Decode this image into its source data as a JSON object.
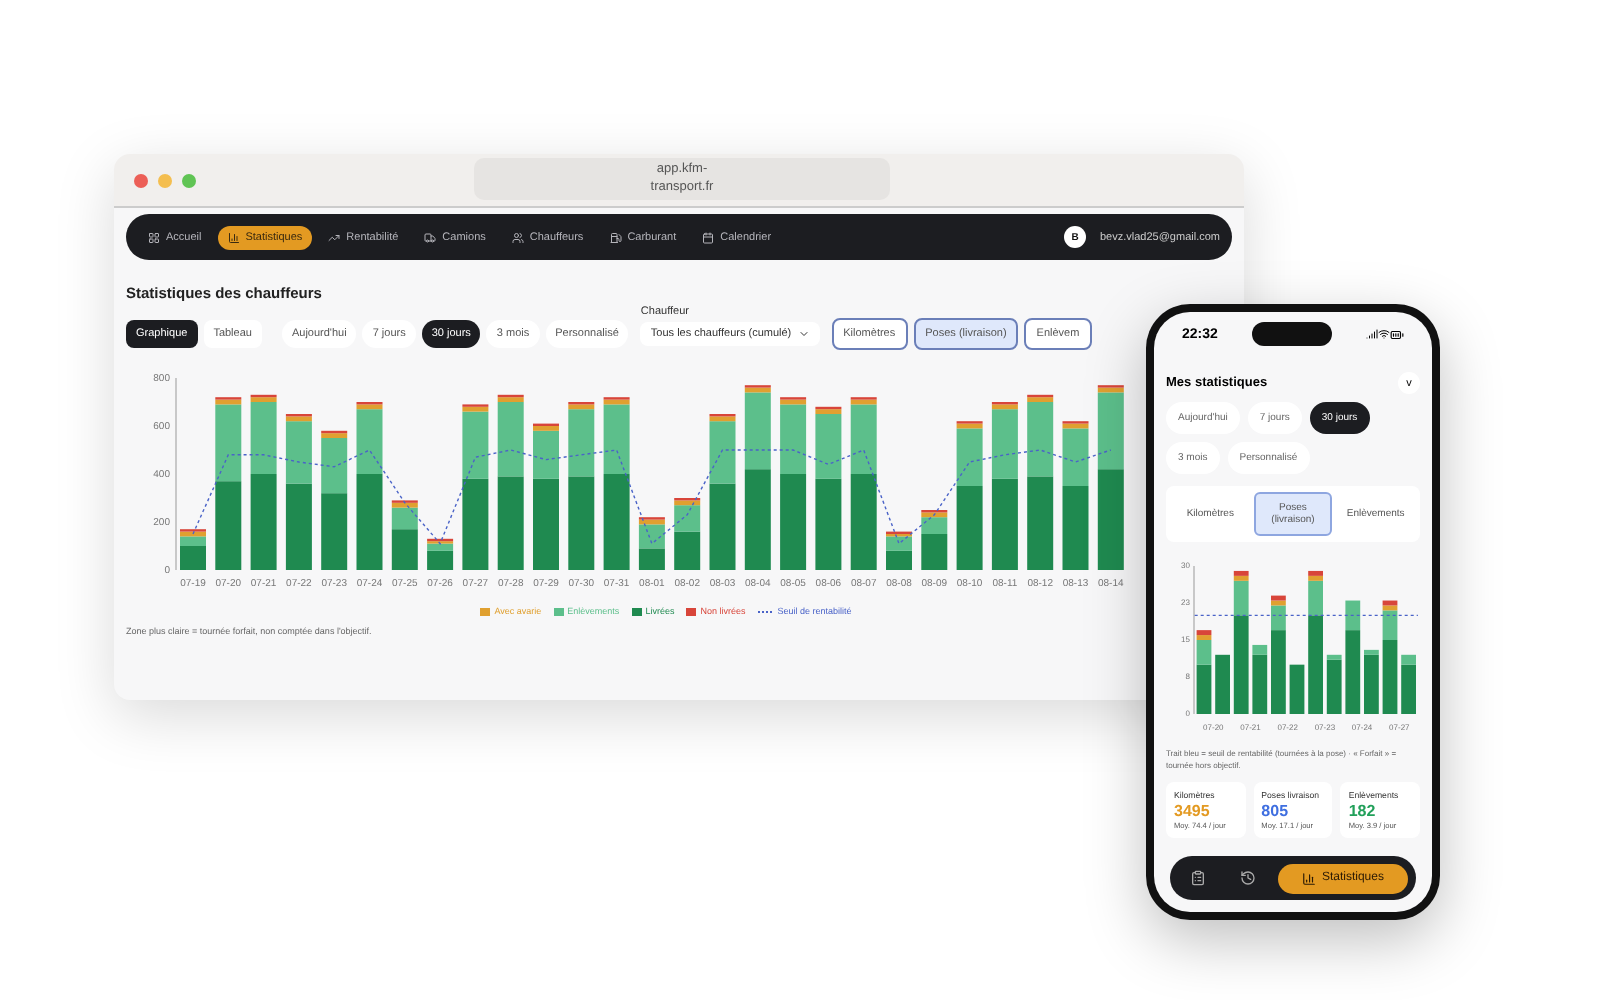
{
  "browser": {
    "address": "app.kfm-transport.fr",
    "nav": [
      {
        "label": "Accueil",
        "selected": false
      },
      {
        "label": "Statistiques",
        "selected": true
      },
      {
        "label": "Rentabilité",
        "selected": false
      },
      {
        "label": "Camions",
        "selected": false
      },
      {
        "label": "Chauffeurs",
        "selected": false
      },
      {
        "label": "Carburant",
        "selected": false
      },
      {
        "label": "Calendrier",
        "selected": false
      }
    ],
    "user": {
      "initial": "B",
      "email": "bevz.vlad25@gmail.com"
    },
    "title": "Statistiques des chauffeurs",
    "views": [
      {
        "label": "Graphique",
        "selected": true
      },
      {
        "label": "Tableau",
        "selected": false
      }
    ],
    "periods": [
      {
        "label": "Aujourd'hui",
        "selected": false
      },
      {
        "label": "7 jours",
        "selected": false
      },
      {
        "label": "30 jours",
        "selected": true
      },
      {
        "label": "3 mois",
        "selected": false
      },
      {
        "label": "Personnalisé",
        "selected": false
      }
    ],
    "driver": {
      "label": "Chauffeur",
      "value": "Tous les chauffeurs (cumulé)"
    },
    "metrics": [
      {
        "label": "Kilomètres",
        "selected": false
      },
      {
        "label": "Poses (livraison)",
        "selected": true
      },
      {
        "label": "Enlèvem",
        "selected": false
      }
    ],
    "chart_data": {
      "type": "bar",
      "stacked": true,
      "categories": [
        "07-19",
        "07-20",
        "07-21",
        "07-22",
        "07-23",
        "07-24",
        "07-25",
        "07-26",
        "07-27",
        "07-28",
        "07-29",
        "07-30",
        "07-31",
        "08-01",
        "08-02",
        "08-03",
        "08-04",
        "08-05",
        "08-06",
        "08-07",
        "08-08",
        "08-09",
        "08-10",
        "08-11",
        "08-12",
        "08-13",
        "08-14"
      ],
      "ylim": [
        0,
        800
      ],
      "yticks": [
        0,
        200,
        400,
        600,
        800
      ],
      "series": [
        {
          "name": "Avec avarie",
          "color": "#e0a030",
          "values": [
            20,
            20,
            20,
            20,
            20,
            20,
            20,
            10,
            20,
            20,
            20,
            20,
            20,
            20,
            20,
            20,
            20,
            20,
            20,
            20,
            10,
            20,
            20,
            20,
            20,
            20,
            20
          ]
        },
        {
          "name": "Enlèvements",
          "color": "#5cbf8b",
          "values": [
            40,
            320,
            300,
            260,
            230,
            270,
            90,
            30,
            280,
            310,
            200,
            280,
            290,
            100,
            110,
            260,
            320,
            290,
            270,
            290,
            60,
            70,
            240,
            290,
            310,
            240,
            320
          ]
        },
        {
          "name": "Livrées",
          "color": "#1f8a50",
          "values": [
            100,
            370,
            400,
            360,
            320,
            400,
            170,
            80,
            380,
            390,
            380,
            390,
            400,
            90,
            160,
            360,
            420,
            400,
            380,
            400,
            80,
            150,
            350,
            380,
            390,
            350,
            420
          ]
        },
        {
          "name": "Non livrées",
          "color": "#d8453a",
          "values": [
            10,
            10,
            10,
            10,
            10,
            10,
            10,
            10,
            10,
            10,
            10,
            10,
            10,
            10,
            10,
            10,
            10,
            10,
            10,
            10,
            10,
            10,
            10,
            10,
            10,
            10,
            10
          ]
        },
        {
          "name": "Seuil de rentabilité",
          "color": "#4a63c8",
          "type": "line",
          "line_style": "dashed",
          "values": [
            150,
            480,
            480,
            450,
            430,
            500,
            280,
            110,
            470,
            500,
            460,
            480,
            500,
            110,
            230,
            500,
            500,
            500,
            440,
            500,
            110,
            230,
            450,
            480,
            500,
            450,
            500
          ]
        }
      ]
    },
    "note": "Zone plus claire = tournée forfait, non comptée dans l'objectif."
  },
  "phone": {
    "time": "22:32",
    "title": "Mes statistiques",
    "toggle": "v",
    "periods": [
      {
        "label": "Aujourd'hui",
        "selected": false
      },
      {
        "label": "7 jours",
        "selected": false
      },
      {
        "label": "30 jours",
        "selected": true
      },
      {
        "label": "3 mois",
        "selected": false
      },
      {
        "label": "Personnalisé",
        "selected": false
      }
    ],
    "metrics": [
      {
        "label": "Kilomètres",
        "selected": false
      },
      {
        "label": "Poses (livraison)",
        "selected": true
      },
      {
        "label": "Enlèvements",
        "selected": false
      }
    ],
    "chart_data": {
      "type": "bar",
      "stacked": true,
      "categories": [
        "07-20",
        null,
        "07-21",
        null,
        "07-22",
        null,
        "07-23",
        null,
        "07-24",
        null,
        "07-27",
        null
      ],
      "ylim": [
        0,
        30
      ],
      "yticks": [
        0,
        {
          "value": 7.5,
          "label": "8"
        },
        15,
        {
          "value": 22.5,
          "label": "23"
        },
        30
      ],
      "series": [
        {
          "color": "#1f8a50",
          "values": [
            10,
            12,
            20,
            12,
            17,
            10,
            20,
            11,
            17,
            12,
            15,
            10
          ]
        },
        {
          "color": "#5cbf8b",
          "values": [
            5,
            0,
            7,
            2,
            5,
            0,
            7,
            1,
            6,
            1,
            6,
            2
          ]
        },
        {
          "color": "#e0a030",
          "values": [
            1,
            0,
            1,
            0,
            1,
            0,
            1,
            0,
            0,
            0,
            1,
            0
          ]
        },
        {
          "color": "#d8453a",
          "values": [
            1,
            0,
            1,
            0,
            1,
            0,
            1,
            0,
            0,
            0,
            1,
            0
          ]
        },
        {
          "color": "#4a63c8",
          "type": "line",
          "line_style": "dashed",
          "values": [
            20,
            20,
            20,
            20,
            20,
            20,
            20,
            20,
            20,
            20,
            20,
            20
          ]
        }
      ]
    },
    "note": "Trait bleu = seuil de rentabilité (tournées à la pose) · « Forfait » = tournée hors objectif.",
    "stats": [
      {
        "label": "Kilomètres",
        "value": "3495",
        "sub": "Moy. 74.4 / jour",
        "color": "#e39a22"
      },
      {
        "label": "Poses livraison",
        "value": "805",
        "sub": "Moy. 17.1 / jour",
        "color": "#3f6fe0"
      },
      {
        "label": "Enlèvements",
        "value": "182",
        "sub": "Moy. 3.9 / jour",
        "color": "#22a05a"
      }
    ],
    "tabbar": {
      "active": "Statistiques"
    }
  }
}
